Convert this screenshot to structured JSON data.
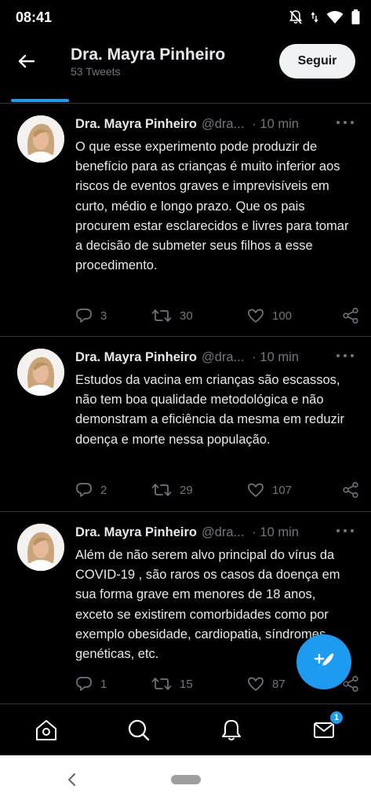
{
  "status_bar": {
    "time": "08:41"
  },
  "header": {
    "name": "Dra. Mayra Pinheiro",
    "tweet_count": "53 Tweets",
    "follow_label": "Seguir"
  },
  "tweets": [
    {
      "name": "Dra. Mayra Pinheiro",
      "handle": "@dra...",
      "time": "· 10 min",
      "text": "O que esse experimento  pode produzir de benefício para as crianças é muito inferior aos riscos de eventos graves e imprevisíveis em curto, médio e longo prazo. Que os pais procurem estar esclarecidos e livres para tomar a decisão de submeter seus filhos a esse procedimento.",
      "replies": "3",
      "retweets": "30",
      "likes": "100"
    },
    {
      "name": "Dra. Mayra Pinheiro",
      "handle": "@dra...",
      "time": "· 10 min",
      "text": "Estudos da vacina em crianças são escassos, não tem boa qualidade metodológica e não demonstram a eficiência da mesma em reduzir doença e morte nessa população.",
      "replies": "2",
      "retweets": "29",
      "likes": "107"
    },
    {
      "name": "Dra. Mayra Pinheiro",
      "handle": "@dra...",
      "time": "· 10 min",
      "text": "Além de não serem alvo principal do vírus da COVID-19 , são raros os casos da doença em sua forma grave em menores de 18 anos, exceto se existirem comorbidades como por exemplo obesidade, cardiopatia, síndromes genéticas, etc.",
      "replies": "1",
      "retweets": "15",
      "likes": "87"
    }
  ],
  "bottom_nav": {
    "items": [
      "home-icon",
      "search-icon",
      "notifications-icon",
      "messages-icon"
    ],
    "messages_badge": "1"
  },
  "colors": {
    "background": "#000000",
    "accent": "#1d9bf0",
    "text_primary": "#e7e9ea",
    "text_secondary": "#71767b",
    "divider": "#2f3336"
  }
}
